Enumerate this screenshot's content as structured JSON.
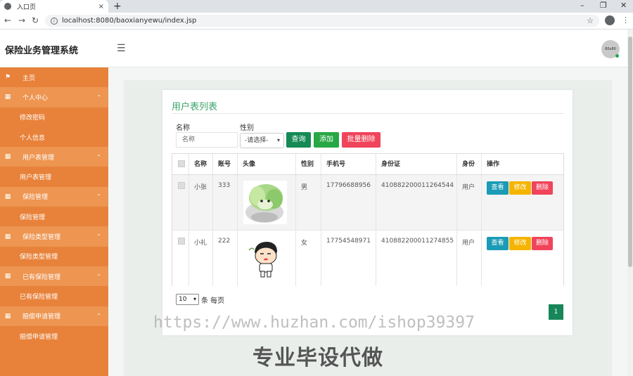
{
  "browser": {
    "tab_title": "入口页",
    "url": "localhost:8080/baoxianyewu/index.jsp",
    "new_tab": "+",
    "tab_close": "×",
    "win_min": "–",
    "win_max": "❐",
    "win_close": "✕",
    "back": "←",
    "forward": "→",
    "reload": "↻",
    "star": "☆",
    "menu": "⋮",
    "info": "i"
  },
  "header": {
    "app_title": "保险业务管理系统",
    "menu_icon": "☰",
    "avatar_text": "80x80"
  },
  "sidebar": {
    "items": [
      {
        "label": "主页",
        "kind": "top",
        "icon": "flag-icon"
      },
      {
        "label": "个人中心",
        "kind": "group",
        "icon": "grid-icon"
      },
      {
        "label": "修改密码",
        "kind": "sub"
      },
      {
        "label": "个人信息",
        "kind": "sub"
      },
      {
        "label": "用户表管理",
        "kind": "group",
        "icon": "grid-icon"
      },
      {
        "label": "用户表管理",
        "kind": "sub"
      },
      {
        "label": "保险管理",
        "kind": "group",
        "icon": "grid-icon"
      },
      {
        "label": "保险管理",
        "kind": "sub"
      },
      {
        "label": "保险类型管理",
        "kind": "group",
        "icon": "grid-icon"
      },
      {
        "label": "保险类型管理",
        "kind": "sub"
      },
      {
        "label": "已有保险管理",
        "kind": "group",
        "icon": "grid-icon"
      },
      {
        "label": "已有保险管理",
        "kind": "sub"
      },
      {
        "label": "赔偿申请管理",
        "kind": "group",
        "icon": "grid-icon"
      },
      {
        "label": "赔偿申请管理",
        "kind": "sub"
      }
    ],
    "flag_glyph": "⚑",
    "grid_glyph": "▦",
    "caret_glyph": "⌃"
  },
  "main": {
    "title": "用户表列表",
    "search": {
      "name_label": "名称",
      "name_placeholder": "名称",
      "gender_label": "性别",
      "gender_selected": "-请选择-",
      "dropdown_glyph": "▾",
      "query_label": "查询",
      "add_label": "添加",
      "batch_delete_label": "批量删除"
    },
    "table": {
      "headers": [
        "名称",
        "账号",
        "头像",
        "性别",
        "手机号",
        "身份证",
        "身份",
        "操作"
      ],
      "rows": [
        {
          "name": "小张",
          "account": "333",
          "gender": "男",
          "phone": "17796688956",
          "id_card": "410882200011264544",
          "role": "用户"
        },
        {
          "name": "小礼",
          "account": "222",
          "gender": "女",
          "phone": "17754548971",
          "id_card": "410882200011274855",
          "role": "用户"
        }
      ],
      "actions": {
        "view": "查看",
        "edit": "修改",
        "delete": "删除"
      }
    },
    "pagination": {
      "page_size": "10",
      "page_size_suffix": "条 每页",
      "current_page": "1"
    }
  },
  "watermark": {
    "url": "https://www.huzhan.com/ishop39397",
    "slogan": "专业毕设代做"
  },
  "colors": {
    "sidebar_bg": "#e8823a",
    "sidebar_group_bg": "#ed9551",
    "title_green": "#3ba36a",
    "query_btn": "#158a55",
    "add_btn": "#28a745",
    "delete_btn": "#f0445a",
    "view_btn": "#1a9bb6",
    "edit_btn": "#f5b400",
    "row_delete_btn": "#f0445a",
    "page_active": "#17865a"
  }
}
